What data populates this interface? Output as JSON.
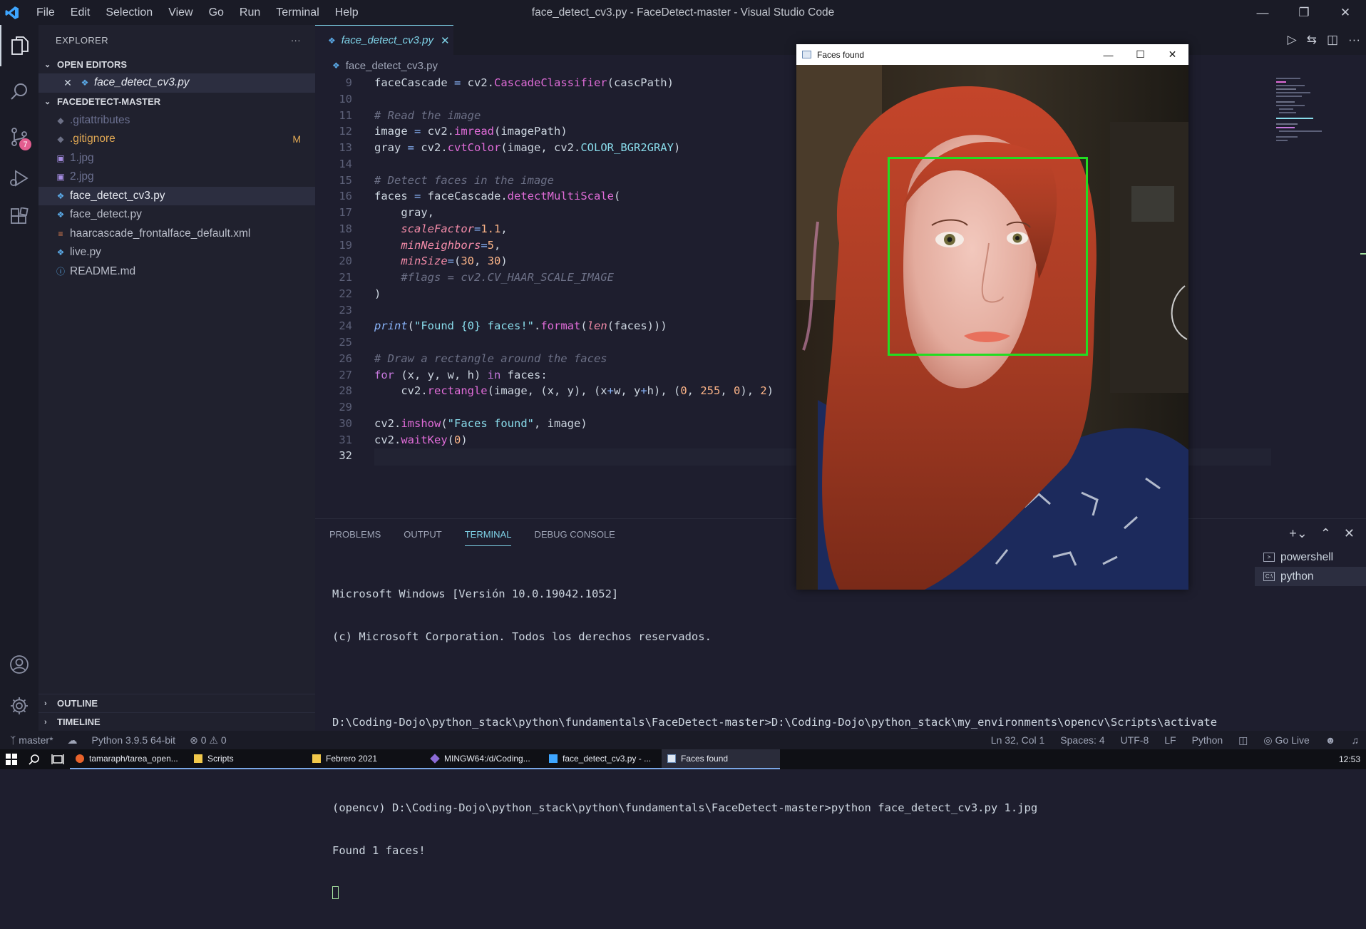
{
  "titlebar": {
    "menu": [
      "File",
      "Edit",
      "Selection",
      "View",
      "Go",
      "Run",
      "Terminal",
      "Help"
    ],
    "title": "face_detect_cv3.py - FaceDetect-master - Visual Studio Code"
  },
  "activity": {
    "scm_badge": "7"
  },
  "sidebar": {
    "header": "EXPLORER",
    "open_editors_label": "OPEN EDITORS",
    "open_editor": "face_detect_cv3.py",
    "folder_label": "FACEDETECT-MASTER",
    "files": [
      {
        "name": ".gitattributes",
        "icon": "git-icon"
      },
      {
        "name": ".gitignore",
        "icon": "git-icon",
        "status": "M"
      },
      {
        "name": "1.jpg",
        "icon": "image-icon"
      },
      {
        "name": "2.jpg",
        "icon": "image-icon"
      },
      {
        "name": "face_detect_cv3.py",
        "icon": "python-icon"
      },
      {
        "name": "face_detect.py",
        "icon": "python-icon"
      },
      {
        "name": "haarcascade_frontalface_default.xml",
        "icon": "xml-icon"
      },
      {
        "name": "live.py",
        "icon": "python-icon"
      },
      {
        "name": "README.md",
        "icon": "info-icon"
      }
    ],
    "outline_label": "OUTLINE",
    "timeline_label": "TIMELINE"
  },
  "editor": {
    "tab": "face_detect_cv3.py",
    "breadcrumb": "face_detect_cv3.py",
    "line_numbers": [
      "9",
      "10",
      "11",
      "12",
      "13",
      "14",
      "15",
      "16",
      "17",
      "18",
      "19",
      "20",
      "21",
      "22",
      "23",
      "24",
      "25",
      "26",
      "27",
      "28",
      "29",
      "30",
      "31",
      "32"
    ],
    "current_line": "32"
  },
  "panel": {
    "tabs": [
      "PROBLEMS",
      "OUTPUT",
      "TERMINAL",
      "DEBUG CONSOLE"
    ],
    "active_tab": "TERMINAL",
    "terminal_lines": [
      "Microsoft Windows [Versión 10.0.19042.1052]",
      "(c) Microsoft Corporation. Todos los derechos reservados.",
      "",
      "D:\\Coding-Dojo\\python_stack\\python\\fundamentals\\FaceDetect-master>D:\\Coding-Dojo\\python_stack\\my_environments\\opencv\\Scripts\\activate",
      "",
      "(opencv) D:\\Coding-Dojo\\python_stack\\python\\fundamentals\\FaceDetect-master>python face_detect_cv3.py 1.jpg",
      "Found 1 faces!"
    ],
    "terminals": [
      "powershell",
      "python"
    ]
  },
  "status": {
    "branch": "master*",
    "python": "Python 3.9.5 64-bit",
    "errors": "0",
    "warnings": "0",
    "position": "Ln 32, Col 1",
    "spaces": "Spaces: 4",
    "encoding": "UTF-8",
    "eol": "LF",
    "language": "Python",
    "golive": "Go Live"
  },
  "taskbar": {
    "tasks": [
      "tamaraph/tarea_open...",
      "Scripts",
      "Febrero 2021",
      "MINGW64:/d/Coding...",
      "face_detect_cv3.py - ...",
      "Faces found"
    ],
    "clock": "12:53"
  },
  "faces_window": {
    "title": "Faces found"
  },
  "colors": {
    "accent": "#7fd3e8",
    "detection_box": "#22dd22",
    "badge": "#e35d8f"
  }
}
